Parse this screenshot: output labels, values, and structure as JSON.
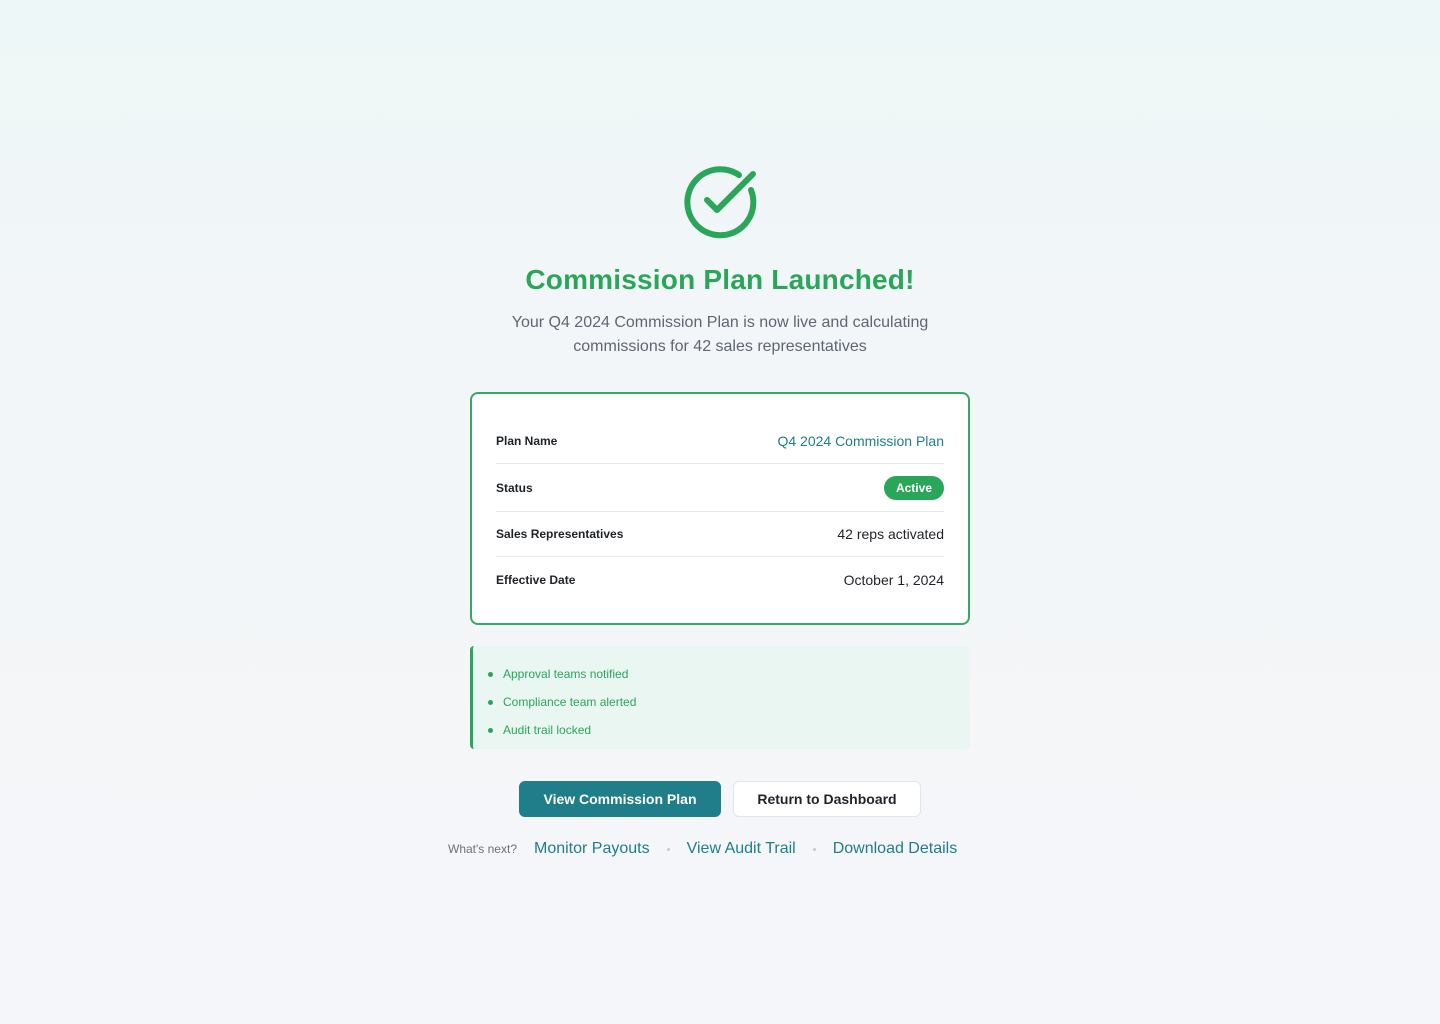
{
  "hero": {
    "icon": "check-circle-icon",
    "title": "Commission Plan Launched!",
    "subtitle": "Your Q4 2024 Commission Plan is now live and calculating commissions for 42 sales representatives"
  },
  "summary": {
    "plan_name_label": "Plan Name",
    "plan_name_value": "Q4 2024 Commission Plan",
    "status_label": "Status",
    "status_value": "Active",
    "reps_label": "Sales Representatives",
    "reps_value": "42 reps activated",
    "date_label": "Effective Date",
    "date_value": "October 1, 2024"
  },
  "notifications": [
    "Approval teams notified",
    "Compliance team alerted",
    "Audit trail locked"
  ],
  "actions": {
    "primary_label": "View Commission Plan",
    "secondary_label": "Return to Dashboard"
  },
  "next_steps": {
    "label": "What's next?",
    "links": [
      "Monitor Payouts",
      "View Audit Trail",
      "Download Details"
    ]
  },
  "colors": {
    "success": "#2aa65a",
    "accent": "#1f7e8a"
  }
}
